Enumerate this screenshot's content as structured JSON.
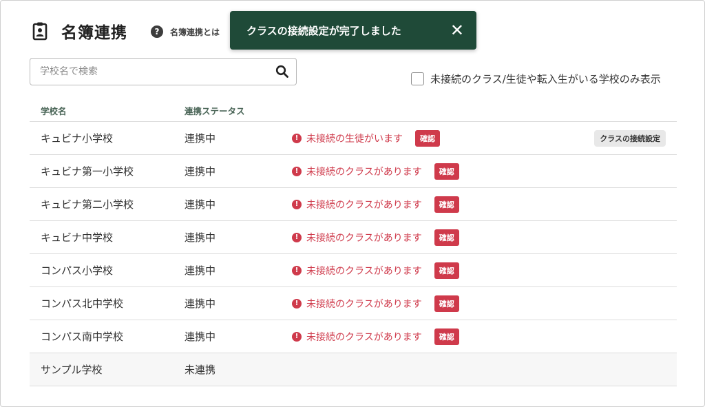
{
  "header": {
    "title": "名簿連携",
    "help_text": "名簿連携とは"
  },
  "toast": {
    "message": "クラスの接続設定が完了しました",
    "close_glyph": "✕"
  },
  "search": {
    "placeholder": "学校名で検索",
    "value": ""
  },
  "filter": {
    "label": "未接続のクラス/生徒や転入生がいる学校のみ表示",
    "checked": false
  },
  "table": {
    "columns": [
      "学校名",
      "連携ステータス"
    ],
    "confirm_label": "確認",
    "class_settings_label": "クラスの接続設定",
    "rows": [
      {
        "name": "キュビナ小学校",
        "status": "連携中",
        "warning": "未接続の生徒がいます"
      },
      {
        "name": "キュビナ第一小学校",
        "status": "連携中",
        "warning": "未接続のクラスがあります"
      },
      {
        "name": "キュビナ第二小学校",
        "status": "連携中",
        "warning": "未接続のクラスがあります"
      },
      {
        "name": "キュビナ中学校",
        "status": "連携中",
        "warning": "未接続のクラスがあります"
      },
      {
        "name": "コンパス小学校",
        "status": "連携中",
        "warning": "未接続のクラスがあります"
      },
      {
        "name": "コンパス北中学校",
        "status": "連携中",
        "warning": "未接続のクラスがあります"
      },
      {
        "name": "コンパス南中学校",
        "status": "連携中",
        "warning": "未接続のクラスがあります"
      },
      {
        "name": "サンプル学校",
        "status": "未連携",
        "warning": ""
      }
    ]
  },
  "colors": {
    "toast_bg": "#1f4a38",
    "warning_red": "#cf3a4b",
    "header_green": "#4a6557"
  },
  "icons": {
    "title": "clipboard-user-icon",
    "help": "question-circle-icon",
    "search": "search-icon",
    "warning": "exclamation-circle-icon",
    "close": "close-icon"
  }
}
